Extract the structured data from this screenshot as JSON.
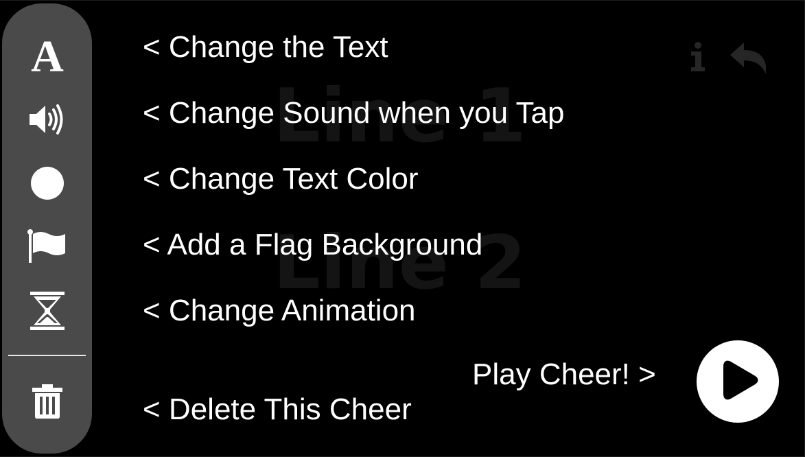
{
  "preview": {
    "line1": "Line 1",
    "line2": "Line 2"
  },
  "hints": {
    "text": "< Change the Text",
    "sound": "< Change Sound when you Tap",
    "color": "< Change Text Color",
    "flag": "< Add a Flag Background",
    "animation": "< Change Animation",
    "delete": "< Delete This Cheer"
  },
  "play": {
    "label": "Play Cheer! >"
  },
  "sidebar": {
    "tools": [
      {
        "icon": "text-icon"
      },
      {
        "icon": "speaker-icon"
      },
      {
        "icon": "color-circle-icon"
      },
      {
        "icon": "flag-icon"
      },
      {
        "icon": "hourglass-icon"
      },
      {
        "icon": "trash-icon"
      }
    ]
  },
  "top_icons": [
    "info-icon",
    "undo-icon"
  ],
  "colors": {
    "background": "#000000",
    "sidebar": "#4a4a4a",
    "foreground": "#ffffff",
    "preview_text": "#141414"
  }
}
